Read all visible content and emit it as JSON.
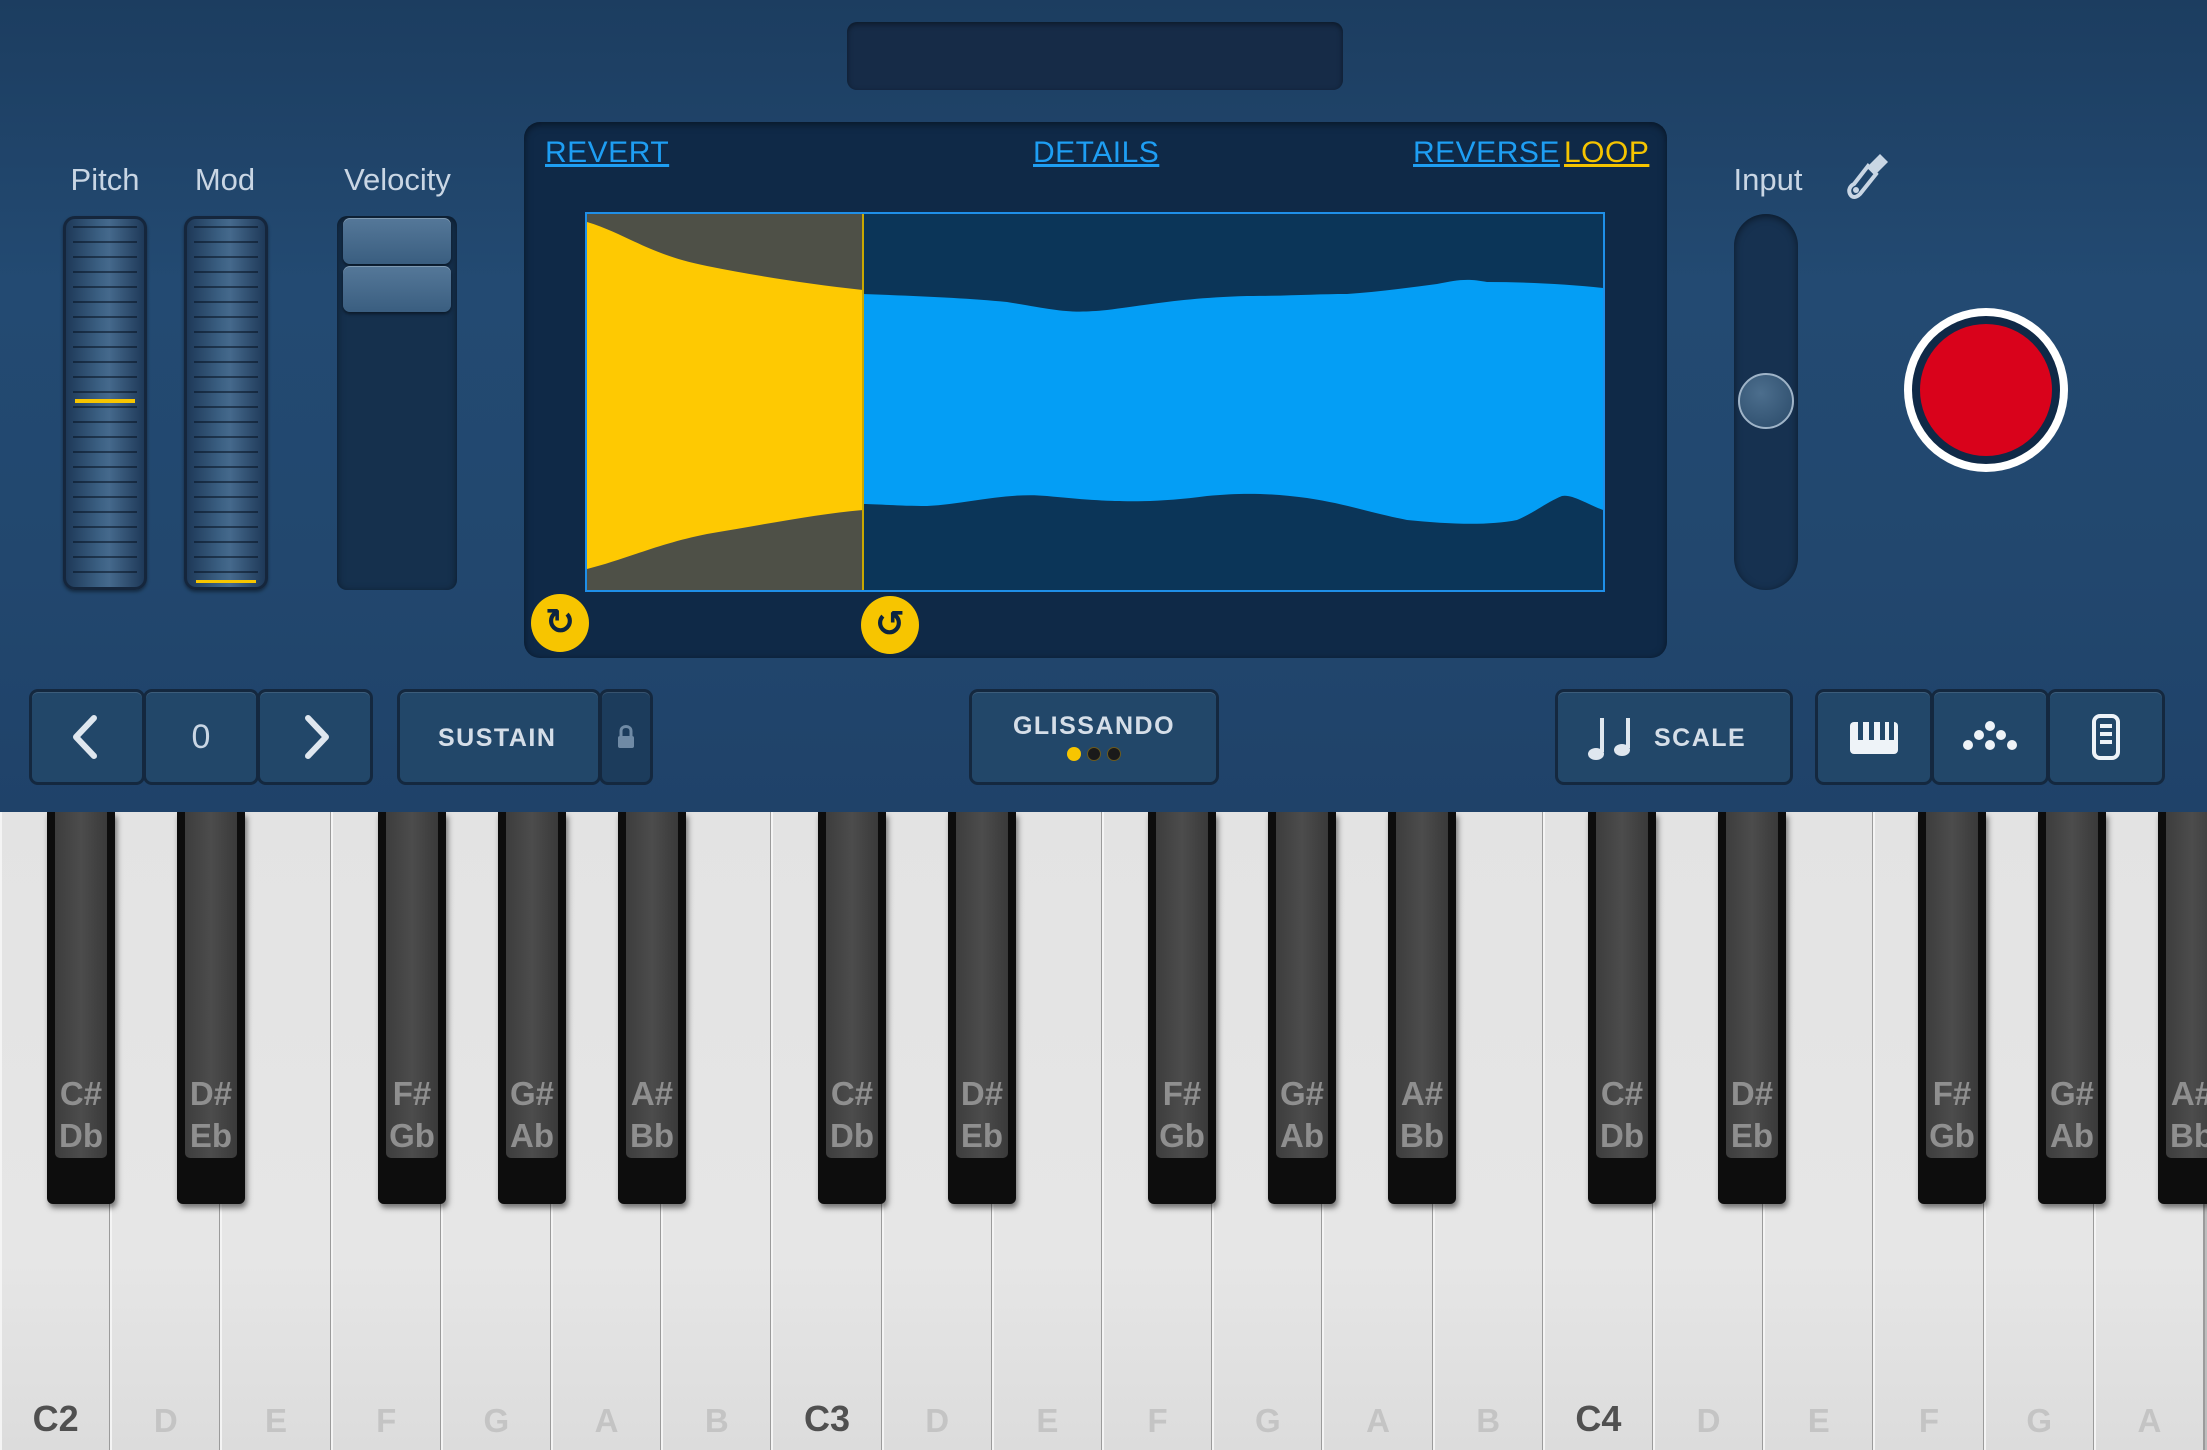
{
  "controls": {
    "pitch_label": "Pitch",
    "mod_label": "Mod",
    "velocity_label": "Velocity",
    "input_label": "Input"
  },
  "sample_editor": {
    "revert": "REVERT",
    "details": "DETAILS",
    "reverse": "REVERSE",
    "loop": "LOOP",
    "loop_active": true
  },
  "toolbar": {
    "octave_value": "0",
    "sustain": "SUSTAIN",
    "glissando": "GLISSANDO",
    "scale": "SCALE"
  },
  "keyboard": {
    "white_keys": [
      "C2",
      "D",
      "E",
      "F",
      "G",
      "A",
      "B",
      "C3",
      "D",
      "E",
      "F",
      "G",
      "A",
      "B",
      "C4",
      "D",
      "E",
      "F",
      "G",
      "A"
    ],
    "black_keys": [
      {
        "top": "C#",
        "bottom": "Db"
      },
      {
        "top": "D#",
        "bottom": "Eb"
      },
      {
        "top": "F#",
        "bottom": "Gb"
      },
      {
        "top": "G#",
        "bottom": "Ab"
      },
      {
        "top": "A#",
        "bottom": "Bb"
      },
      {
        "top": "C#",
        "bottom": "Db"
      },
      {
        "top": "D#",
        "bottom": "Eb"
      },
      {
        "top": "F#",
        "bottom": "Gb"
      },
      {
        "top": "G#",
        "bottom": "Ab"
      },
      {
        "top": "A#",
        "bottom": "Bb"
      },
      {
        "top": "C#",
        "bottom": "Db"
      },
      {
        "top": "D#",
        "bottom": "Eb"
      },
      {
        "top": "F#",
        "bottom": "Gb"
      },
      {
        "top": "G#",
        "bottom": "Ab"
      },
      {
        "top": "A#",
        "bottom": "Bb"
      }
    ]
  },
  "colors": {
    "accent_yellow": "#f7c500",
    "waveform_blue": "#049ef5",
    "record_red": "#d9021b",
    "panel_bg": "#22476e"
  }
}
